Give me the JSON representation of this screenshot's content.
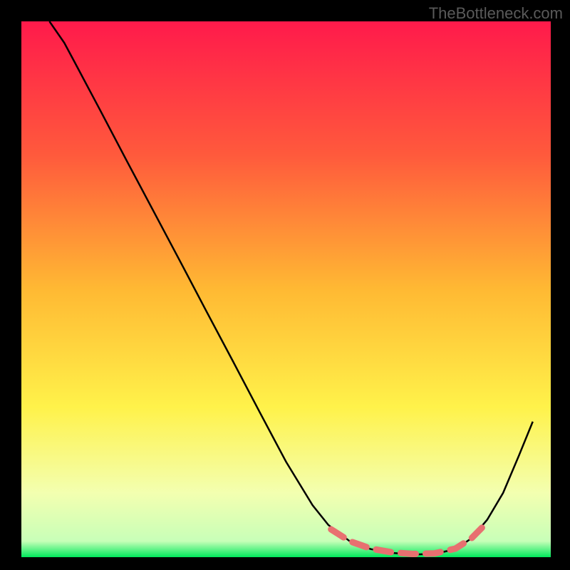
{
  "watermark": "TheBottleneck.com",
  "chart_data": {
    "type": "line",
    "title": "",
    "xlabel": "",
    "ylabel": "",
    "xlim": [
      0,
      100
    ],
    "ylim": [
      0,
      100
    ],
    "notes": "Axes and tick labels not rendered in image; values are estimated relative coordinates (0–100) derived from pixel positions of the curve inside the square plot region.",
    "background_gradient": {
      "stops": [
        {
          "pos": 0.0,
          "color": "#ff1a4b"
        },
        {
          "pos": 0.25,
          "color": "#ff5a3c"
        },
        {
          "pos": 0.5,
          "color": "#ffb933"
        },
        {
          "pos": 0.72,
          "color": "#fff24a"
        },
        {
          "pos": 0.88,
          "color": "#f3ffb0"
        },
        {
          "pos": 0.97,
          "color": "#c8ffb8"
        },
        {
          "pos": 1.0,
          "color": "#00e85c"
        }
      ]
    },
    "series": [
      {
        "name": "curve",
        "color": "#000000",
        "stroke_width": 2.5,
        "x": [
          5.3,
          8.1,
          10.0,
          15.0,
          20.0,
          25.0,
          30.0,
          35.0,
          40.0,
          45.0,
          50.0,
          55.0,
          58.0,
          62.0,
          66.0,
          70.0,
          74.0,
          78.0,
          82.0,
          85.0,
          88.0,
          91.0,
          94.0,
          96.6
        ],
        "y": [
          100.0,
          96.0,
          92.5,
          83.2,
          73.8,
          64.5,
          55.2,
          45.8,
          36.5,
          27.1,
          17.8,
          9.7,
          6.0,
          3.0,
          1.5,
          0.8,
          0.5,
          0.6,
          1.5,
          3.5,
          7.0,
          12.0,
          19.0,
          25.3
        ]
      },
      {
        "name": "optimal-dashes",
        "color": "#e87070",
        "stroke_width": 9,
        "dash": "21 14",
        "linecap": "round",
        "x": [
          58.5,
          62.0,
          66.0,
          70.0,
          74.0,
          78.0,
          82.0,
          85.0,
          87.0
        ],
        "y": [
          5.2,
          3.0,
          1.6,
          0.9,
          0.6,
          0.7,
          1.6,
          3.5,
          5.5
        ]
      }
    ]
  }
}
